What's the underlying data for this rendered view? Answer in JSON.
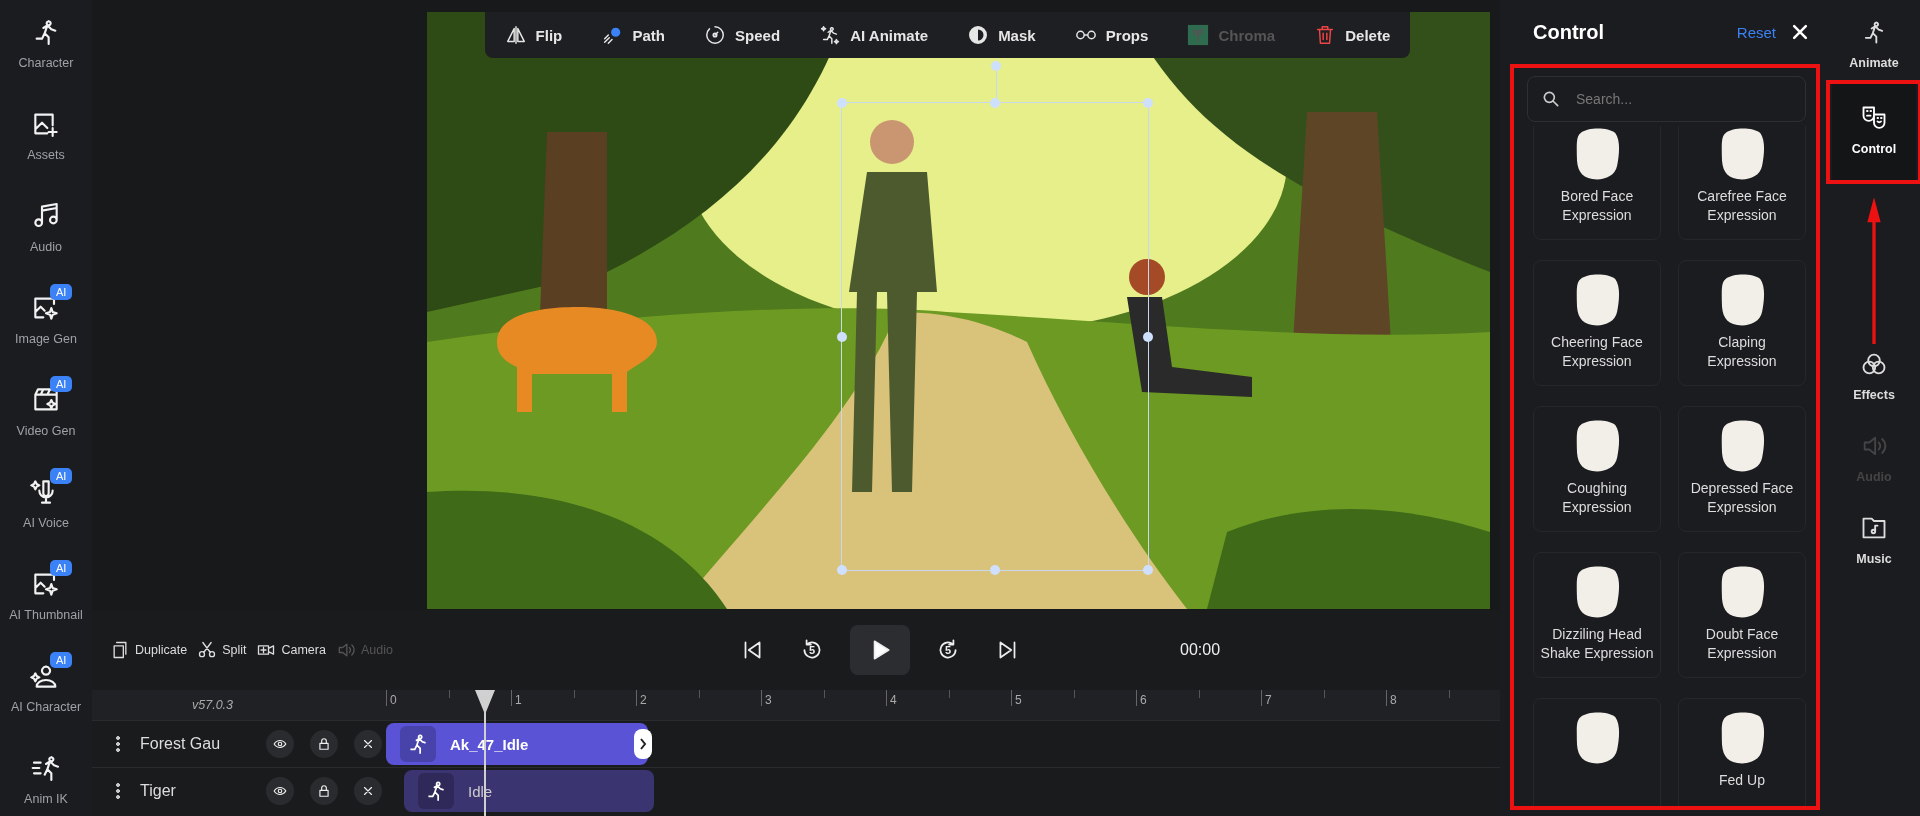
{
  "sidebar": {
    "items": [
      {
        "label": "Character",
        "kind": "run"
      },
      {
        "label": "Assets",
        "kind": "image-plus"
      },
      {
        "label": "Audio",
        "kind": "music"
      },
      {
        "label": "Image Gen",
        "kind": "image-ai",
        "badge": "AI"
      },
      {
        "label": "Video Gen",
        "kind": "video",
        "badge": "AI"
      },
      {
        "label": "AI Voice",
        "kind": "mic",
        "badge": "AI"
      },
      {
        "label": "AI Thumbnail",
        "kind": "image-ai",
        "badge": "AI"
      },
      {
        "label": "AI Character",
        "kind": "person-ai",
        "badge": "AI"
      },
      {
        "label": "Anim IK",
        "kind": "run-lines"
      }
    ]
  },
  "toolbar": [
    {
      "label": "Flip",
      "kind": "flip",
      "disabled": false
    },
    {
      "label": "Path",
      "kind": "path",
      "disabled": false
    },
    {
      "label": "Speed",
      "kind": "speed",
      "disabled": false
    },
    {
      "label": "AI Animate",
      "kind": "animate",
      "disabled": false
    },
    {
      "label": "Mask",
      "kind": "mask",
      "disabled": false
    },
    {
      "label": "Props",
      "kind": "props",
      "disabled": false
    },
    {
      "label": "Chroma",
      "kind": "chroma",
      "disabled": true
    },
    {
      "label": "Delete",
      "kind": "delete",
      "disabled": false
    }
  ],
  "controls": {
    "tools": [
      {
        "label": "Duplicate",
        "kind": "duplicate",
        "disabled": false
      },
      {
        "label": "Split",
        "kind": "split",
        "disabled": false
      },
      {
        "label": "Camera",
        "kind": "camera",
        "disabled": false
      },
      {
        "label": "Audio",
        "kind": "speaker",
        "disabled": true
      }
    ],
    "transport": [
      {
        "kind": "start"
      },
      {
        "kind": "back",
        "label": "5"
      },
      {
        "kind": "play"
      },
      {
        "kind": "forward",
        "label": "5"
      },
      {
        "kind": "end"
      }
    ],
    "time": "00:00"
  },
  "timeline": {
    "version": "v57.0.3",
    "ticks": [
      "0",
      "1",
      "2",
      "3",
      "4",
      "5",
      "6",
      "7",
      "8"
    ],
    "tracks": [
      {
        "name": "Forest Gau",
        "clip": "Ak_47_Idle",
        "selected": true
      },
      {
        "name": "Tiger",
        "clip": "Idle",
        "selected": false
      }
    ]
  },
  "panel": {
    "title": "Control",
    "reset": "Reset",
    "search": {
      "placeholder": "Search..."
    },
    "items": [
      {
        "kind": "expression",
        "label": "Bored Face Expression"
      },
      {
        "kind": "expression",
        "label": "Carefree Face Expression"
      },
      {
        "kind": "expression",
        "label": "Cheering Face Expression"
      },
      {
        "kind": "expression",
        "label": "Claping Expression"
      },
      {
        "kind": "expression",
        "label": "Coughing Expression"
      },
      {
        "kind": "expression",
        "label": "Depressed Face Expression"
      },
      {
        "kind": "expression",
        "label": "Dizziling Head Shake Expression"
      },
      {
        "kind": "expression",
        "label": "Doubt Face Expression"
      },
      {
        "kind": "expression"
      },
      {
        "kind": "expression",
        "label": "Fed Up"
      }
    ]
  },
  "rail": [
    {
      "label": "Animate",
      "kind": "run",
      "selected": false,
      "disabled": false
    },
    {
      "label": "Control",
      "kind": "masks",
      "selected": true,
      "disabled": false
    },
    {
      "label": "Effects",
      "kind": "effects",
      "selected": false,
      "disabled": false
    },
    {
      "label": "Audio",
      "kind": "speaker",
      "selected": false,
      "disabled": true
    },
    {
      "label": "Music",
      "kind": "music-folder",
      "selected": false,
      "disabled": false
    }
  ]
}
